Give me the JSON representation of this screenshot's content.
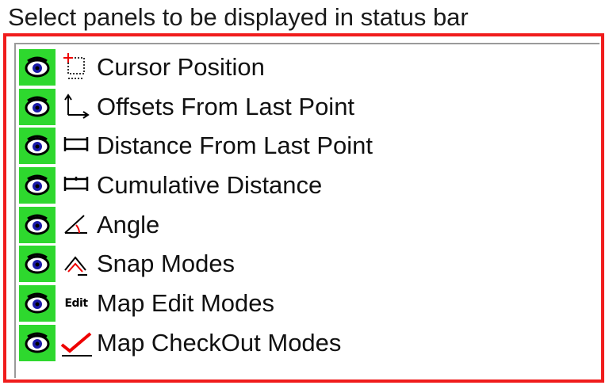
{
  "heading": "Select panels to be displayed in status bar",
  "panels": [
    {
      "label": "Cursor Position",
      "icon": "cursor-position-icon",
      "visible": true
    },
    {
      "label": "Offsets From Last Point",
      "icon": "offsets-icon",
      "visible": true
    },
    {
      "label": "Distance From Last Point",
      "icon": "distance-icon",
      "visible": true
    },
    {
      "label": "Cumulative Distance",
      "icon": "cumulative-distance-icon",
      "visible": true
    },
    {
      "label": "Angle",
      "icon": "angle-icon",
      "visible": true
    },
    {
      "label": "Snap Modes",
      "icon": "snap-modes-icon",
      "visible": true
    },
    {
      "label": "Map Edit Modes",
      "icon": "map-edit-icon",
      "icon_text": "Edit",
      "visible": true
    },
    {
      "label": "Map CheckOut Modes",
      "icon": "checkout-icon",
      "visible": true
    }
  ],
  "colors": {
    "eye_bg": "#2ed82e",
    "highlight_border": "#f01c1c"
  }
}
